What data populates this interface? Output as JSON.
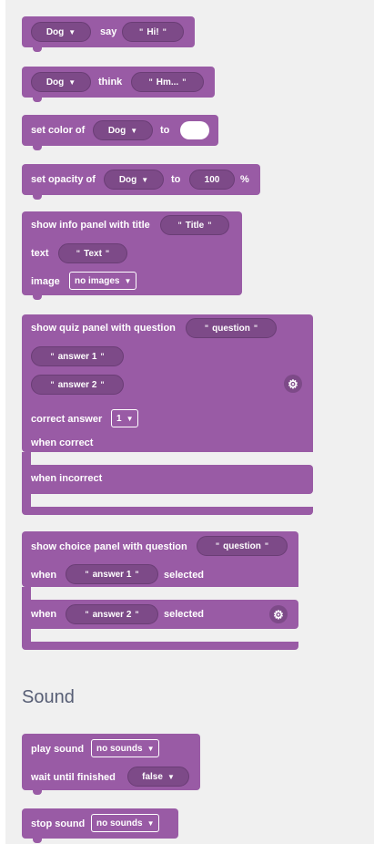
{
  "blocks": {
    "say": {
      "sprite": "Dog",
      "word": "say",
      "text": "Hi!"
    },
    "think": {
      "sprite": "Dog",
      "word": "think",
      "text": "Hm..."
    },
    "set_color": {
      "prefix": "set color of",
      "sprite": "Dog",
      "to": "to"
    },
    "set_opacity": {
      "prefix": "set opacity of",
      "sprite": "Dog",
      "to": "to",
      "value": "100",
      "unit": "%"
    },
    "info_panel": {
      "title_label": "show info panel with title",
      "title": "Title",
      "text_label": "text",
      "text": "Text",
      "image_label": "image",
      "image": "no images"
    },
    "quiz_panel": {
      "label": "show quiz panel with question",
      "question": "question",
      "answer1": "answer 1",
      "answer2": "answer 2",
      "correct_label": "correct answer",
      "correct_value": "1",
      "when_correct": "when correct",
      "when_incorrect": "when incorrect"
    },
    "choice_panel": {
      "label": "show choice panel with question",
      "question": "question",
      "when1": "when",
      "answer1": "answer 1",
      "selected1": "selected",
      "when2": "when",
      "answer2": "answer 2",
      "selected2": "selected"
    }
  },
  "sound": {
    "heading": "Sound",
    "play": {
      "label": "play sound",
      "sound": "no sounds",
      "wait_label": "wait until finished",
      "wait_value": "false"
    },
    "stop": {
      "label": "stop sound",
      "sound": "no sounds"
    }
  },
  "icons": {
    "chevron": "chevron-down-icon",
    "gear": "gear-icon"
  },
  "colors": {
    "block": "#995ba5",
    "field": "#7d4a88",
    "panel": "#f0f0f0",
    "heading": "#575e75"
  }
}
